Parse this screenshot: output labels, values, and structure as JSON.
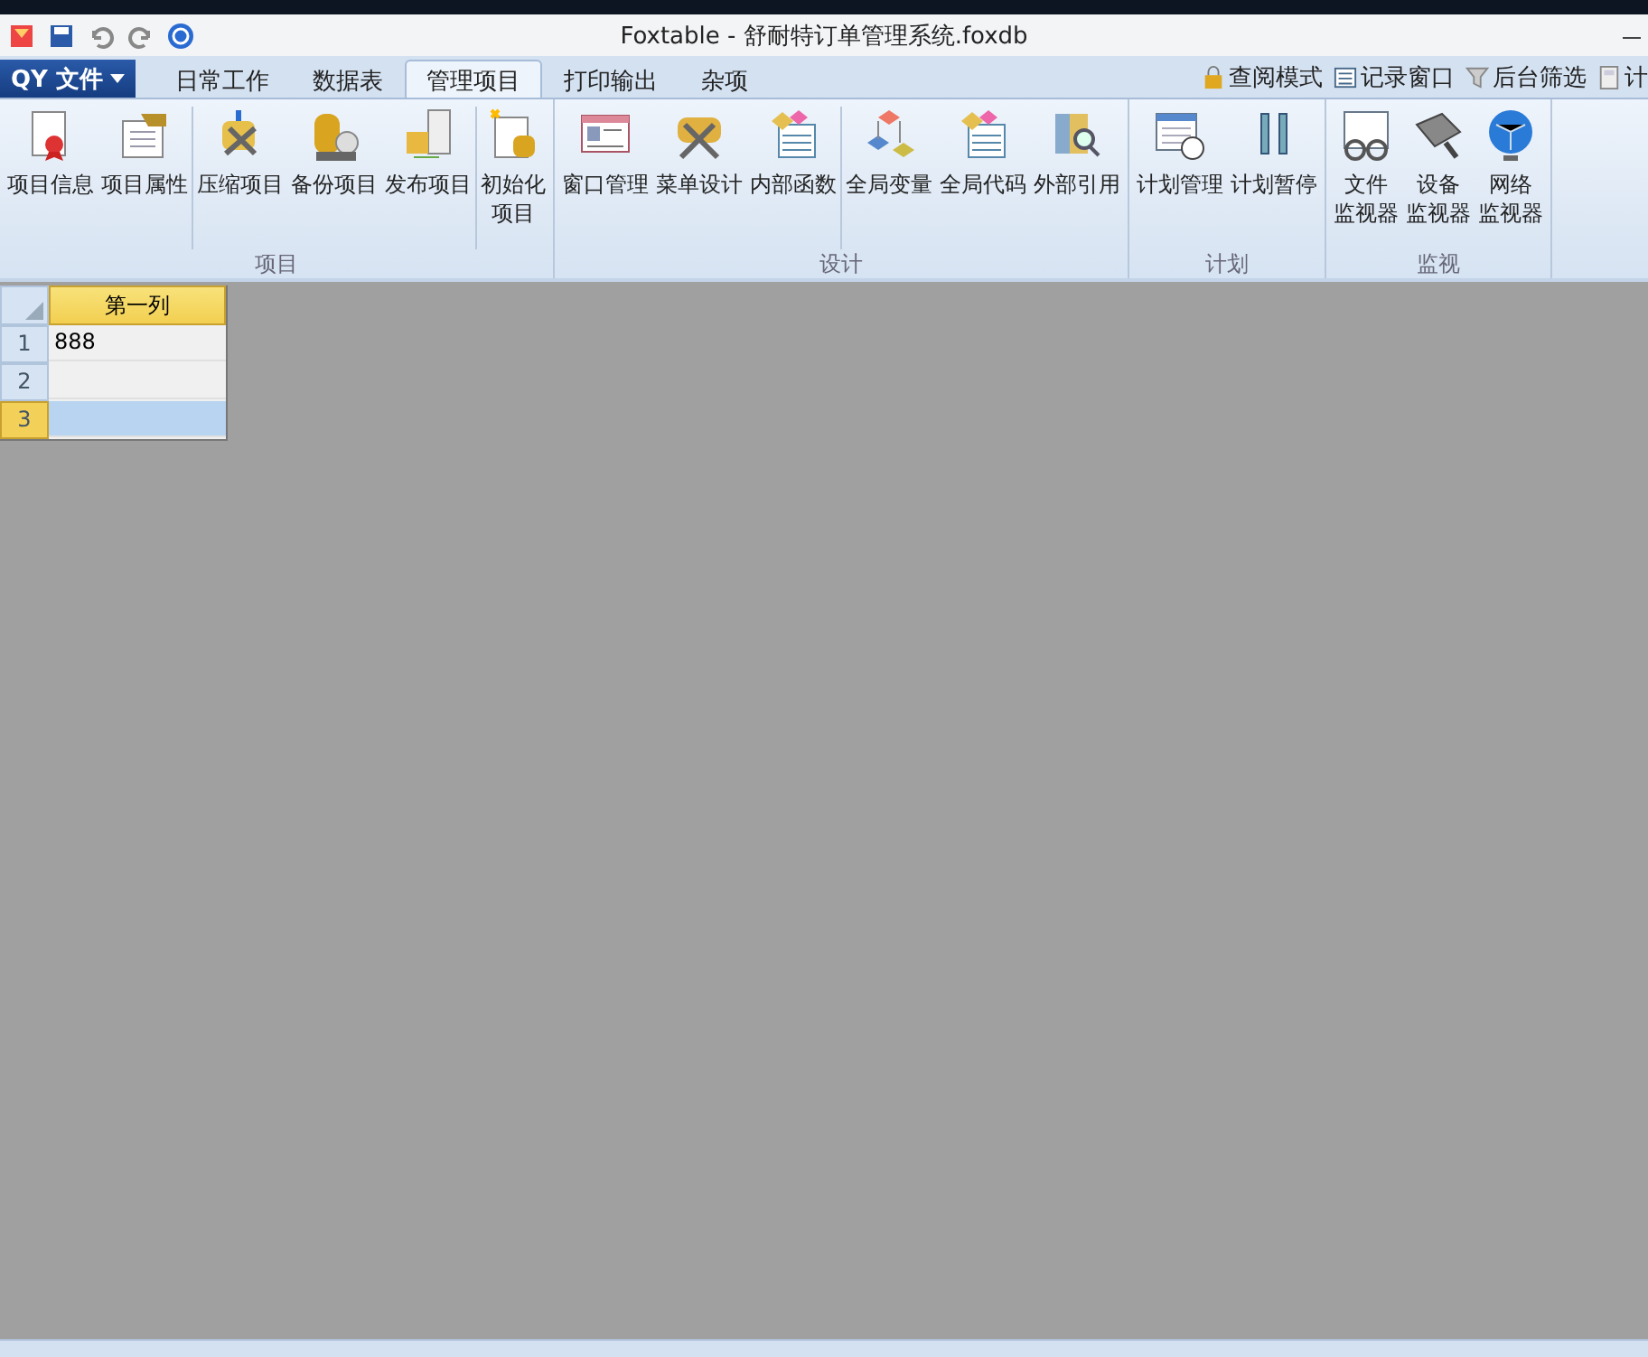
{
  "window": {
    "title": "Foxtable - 舒耐特订单管理系统.foxdb"
  },
  "file_menu": {
    "label": "QY 文件"
  },
  "tabs": [
    {
      "label": "日常工作",
      "selected": false
    },
    {
      "label": "数据表",
      "selected": false
    },
    {
      "label": "管理项目",
      "selected": true
    },
    {
      "label": "打印输出",
      "selected": false
    },
    {
      "label": "杂项",
      "selected": false
    }
  ],
  "quick_tools": [
    {
      "label": "查阅模式"
    },
    {
      "label": "记录窗口"
    },
    {
      "label": "后台筛选"
    },
    {
      "label": "计"
    }
  ],
  "ribbon_groups": [
    {
      "title": "项目",
      "sections": [
        [
          {
            "lines": [
              "项目信息"
            ]
          },
          {
            "lines": [
              "项目属性"
            ]
          }
        ],
        [
          {
            "lines": [
              "压缩项目"
            ]
          },
          {
            "lines": [
              "备份项目"
            ]
          },
          {
            "lines": [
              "发布项目"
            ]
          }
        ],
        [
          {
            "lines": [
              "初始化",
              "项目"
            ]
          }
        ]
      ]
    },
    {
      "title": "设计",
      "sections": [
        [
          {
            "lines": [
              "窗口管理"
            ]
          },
          {
            "lines": [
              "菜单设计"
            ]
          },
          {
            "lines": [
              "内部函数"
            ]
          }
        ],
        [
          {
            "lines": [
              "全局变量"
            ]
          },
          {
            "lines": [
              "全局代码"
            ]
          },
          {
            "lines": [
              "外部引用"
            ]
          }
        ]
      ]
    },
    {
      "title": "计划",
      "sections": [
        [
          {
            "lines": [
              "计划管理"
            ]
          },
          {
            "lines": [
              "计划暂停"
            ]
          }
        ]
      ]
    },
    {
      "title": "监视",
      "sections": [
        [
          {
            "lines": [
              "文件",
              "监视器"
            ]
          },
          {
            "lines": [
              "设备",
              "监视器"
            ]
          },
          {
            "lines": [
              "网络",
              "监视器"
            ]
          }
        ]
      ]
    }
  ],
  "table": {
    "columns": [
      "第一列"
    ],
    "rows": [
      {
        "number": "1",
        "cells": [
          "888"
        ],
        "selected": false
      },
      {
        "number": "2",
        "cells": [
          ""
        ],
        "selected": false
      },
      {
        "number": "3",
        "cells": [
          ""
        ],
        "selected": true
      }
    ]
  }
}
